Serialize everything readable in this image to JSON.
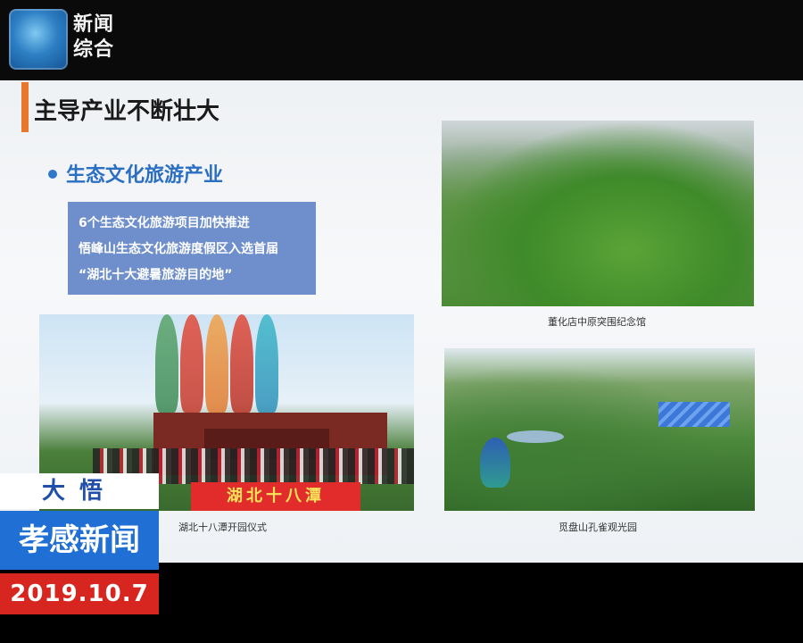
{
  "channel": {
    "logo_line1": "新闻",
    "logo_line2": "综合"
  },
  "slide": {
    "title": "主导产业不断壮大",
    "bullet": "生态文化旅游产业",
    "info_lines": [
      "6个生态文化旅游项目加快推进",
      "悟峰山生态文化旅游度假区入选首届",
      "“湖北十大避暑旅游目的地”"
    ],
    "photos": [
      {
        "caption": "董化店中原突围纪念馆"
      },
      {
        "caption": "湖北十八潭开园仪式",
        "banner": "湖北十八潭"
      },
      {
        "caption": "觅盘山孔雀观光园"
      }
    ]
  },
  "lower_third": {
    "location": "大悟",
    "program": "孝感新闻",
    "date": "2019.10.7"
  },
  "colors": {
    "accent_orange": "#e8762b",
    "bullet_blue": "#2b6fc3",
    "info_box": "#6f8fcc",
    "program_blue": "#1f6fd4",
    "date_red": "#d7261f"
  }
}
